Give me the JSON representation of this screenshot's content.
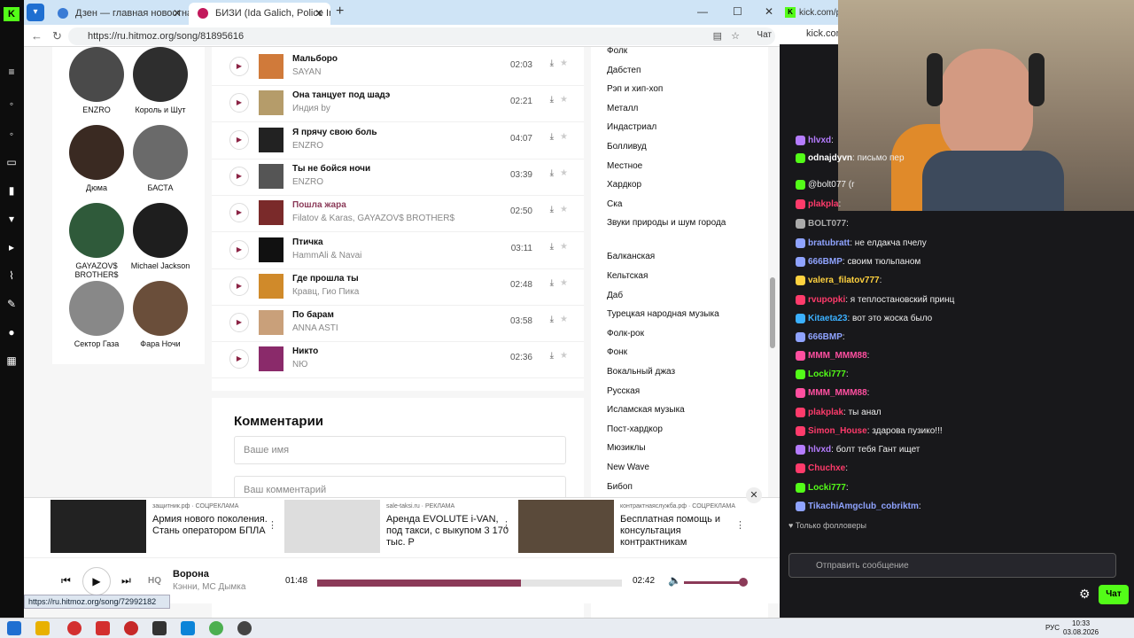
{
  "browser": {
    "tab1": "Дзен — главная новостная инф",
    "tab2": "БИЗИ (Ida Galich, Police In Paris)",
    "url": "https://ru.hitmoz.org/song/81895616",
    "chat_label": "Чат",
    "status_url": "https://ru.hitmoz.org/song/72992182",
    "right_tab": "kick.com/po",
    "right_addr": "kick.com"
  },
  "artists": [
    {
      "name": "ENZRO"
    },
    {
      "name": "Король и Шут"
    },
    {
      "name": "Дюма"
    },
    {
      "name": "БАСТА"
    },
    {
      "name": "GAYAZOV$ BROTHER$"
    },
    {
      "name": "Michael Jackson"
    },
    {
      "name": "Сектор Газа"
    },
    {
      "name": "Фара Ночи"
    }
  ],
  "songs": [
    {
      "title": "Мальборо",
      "artist": "SAYAN",
      "duration": "02:03"
    },
    {
      "title": "Она танцует под шадэ",
      "artist": "Индия by",
      "duration": "02:21"
    },
    {
      "title": "Я прячу свою боль",
      "artist": "ENZRO",
      "duration": "04:07"
    },
    {
      "title": "Ты не бойся ночи",
      "artist": "ENZRO",
      "duration": "03:39"
    },
    {
      "title": "Пошла жара",
      "artist": "Filatov & Karas, GAYAZOV$ BROTHER$",
      "duration": "02:50"
    },
    {
      "title": "Птичка",
      "artist": "HammAli & Navai",
      "duration": "03:11"
    },
    {
      "title": "Где прошла ты",
      "artist": "Кравц, Гио Пика",
      "duration": "02:48"
    },
    {
      "title": "По барам",
      "artist": "ANNA ASTI",
      "duration": "03:58"
    },
    {
      "title": "Никто",
      "artist": "NЮ",
      "duration": "02:36"
    }
  ],
  "comments": {
    "title": "Комментарии",
    "name_placeholder": "Ваше имя",
    "comment_placeholder": "Ваш комментарий"
  },
  "genres": [
    "Фолк",
    "Дабстеп",
    "Рэп и хип-хоп",
    "Металл",
    "Индастриал",
    "Болливуд",
    "Местное",
    "Хардкор",
    "Ска",
    "Звуки природы и шум города",
    "Балканская",
    "Кельтская",
    "Даб",
    "Турецкая народная музыка",
    "Фолк-рок",
    "Фонк",
    "Вокальный джаз",
    "Русская",
    "Исламская музыка",
    "Пост-хардкор",
    "Мюзиклы",
    "New Wave",
    "Бибоп"
  ],
  "ads": [
    {
      "source": "защитник.рф",
      "tag": "СОЦРЕКЛАМА",
      "text": "Армия нового поколения. Стань оператором БПЛА"
    },
    {
      "source": "sale-taksi.ru",
      "tag": "РЕКЛАМА",
      "text": "Аренда EVOLUTE i-VAN, под такси, с выкупом 3 170 тыс. Р"
    },
    {
      "source": "контрактнаяслужба.рф",
      "tag": "СОЦРЕКЛАМА",
      "text": "Бесплатная помощь и консультация контрактникам"
    }
  ],
  "player": {
    "quality": "HQ",
    "title": "Ворона",
    "artist": "Кэнни, МС Дымка",
    "current": "01:48",
    "duration": "02:42",
    "progress": 0.67,
    "volume": 0.95
  },
  "chat": [
    {
      "user": "hlvxd",
      "text": "",
      "color": "#b57cff"
    },
    {
      "user": "odnajdyvn",
      "text": "письмо пер",
      "color": "#fff"
    },
    {
      "user": "",
      "text": "@bolt077 (r",
      "color": "#fff"
    },
    {
      "user": "plakpla",
      "text": "",
      "color": "#ff3b6b"
    },
    {
      "user": "BOLT077",
      "text": "",
      "color": "#aaa"
    },
    {
      "user": "bratubratt",
      "text": "не елдакча пчелу",
      "color": "#8fa3ff"
    },
    {
      "user": "666BMP",
      "text": "своим тюльпаном",
      "color": "#8fa3ff"
    },
    {
      "user": "valera_filatov777",
      "text": "",
      "color": "#ffd23f"
    },
    {
      "user": "rvupopki",
      "text": "я теплостановский принц",
      "color": "#ff3b6b"
    },
    {
      "user": "Kitaeta23",
      "text": "вот это жоска было",
      "color": "#3bb0ff"
    },
    {
      "user": "666BMP",
      "text": "",
      "color": "#8fa3ff"
    },
    {
      "user": "MMM_MMM88",
      "text": "",
      "color": "#ff4fa0"
    },
    {
      "user": "Locki777",
      "text": "",
      "color": "#53fc18"
    },
    {
      "user": "MMM_MMM88",
      "text": "",
      "color": "#ff4fa0"
    },
    {
      "user": "plakplak",
      "text": "ты анал",
      "color": "#ff3b6b"
    },
    {
      "user": "Simon_House",
      "text": "здарова пузико!!!",
      "color": "#ff3b6b"
    },
    {
      "user": "hlvxd",
      "text": "болт тебя Гант ищет",
      "color": "#b57cff"
    },
    {
      "user": "Chuchxe",
      "text": "",
      "color": "#ff3b6b"
    },
    {
      "user": "Locki777",
      "text": "",
      "color": "#53fc18"
    },
    {
      "user": "TikachiAmgclub_cobriktm",
      "text": "",
      "color": "#8fa3ff"
    }
  ],
  "chat_ui": {
    "followers_only": "Только фолловеры",
    "placeholder": "Отправить сообщение",
    "send": "Чат"
  },
  "taskbar": {
    "time": "10:33",
    "date": "03.08.2026",
    "lang": "РУС"
  }
}
